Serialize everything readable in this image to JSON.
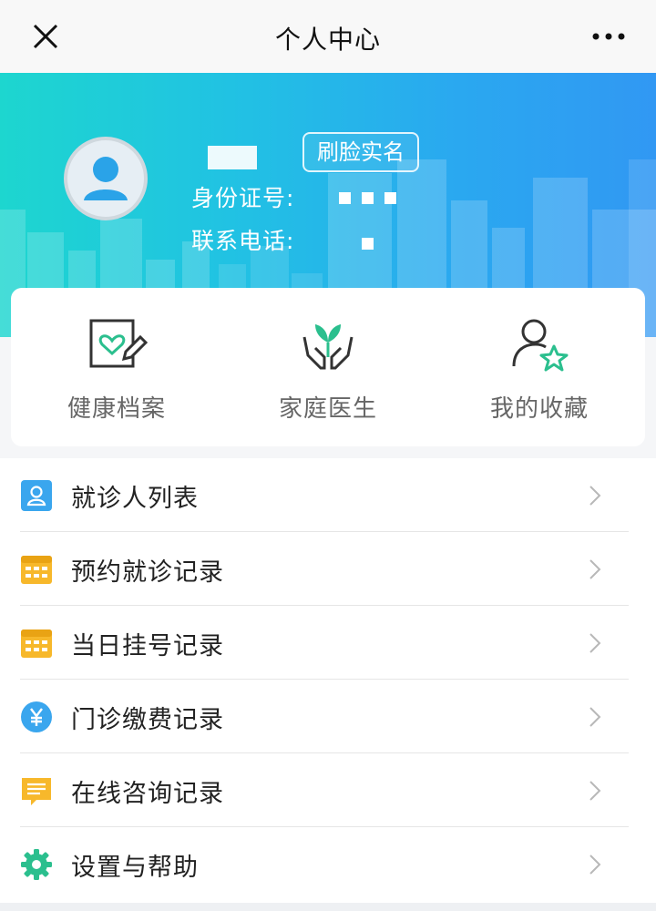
{
  "topbar": {
    "title": "个人中心",
    "close_icon": "close-icon",
    "more_icon": "more-dots-icon"
  },
  "profile": {
    "avatar_icon": "user-avatar-icon",
    "face_verify_label": "刷脸实名",
    "id_label": "身份证号:",
    "phone_label": "联系电话:"
  },
  "quick_actions": [
    {
      "label": "健康档案",
      "icon": "health-record-icon",
      "accent": "#2bbf8e"
    },
    {
      "label": "家庭医生",
      "icon": "family-doctor-icon",
      "accent": "#2bbf8e"
    },
    {
      "label": "我的收藏",
      "icon": "favorites-icon",
      "accent": "#2bbf8e"
    }
  ],
  "menu": [
    {
      "label": "就诊人列表",
      "icon": "patient-list-icon",
      "color": "#3aa6ee"
    },
    {
      "label": "预约就诊记录",
      "icon": "appointment-record-icon",
      "color": "#f7b82b"
    },
    {
      "label": "当日挂号记录",
      "icon": "registration-record-icon",
      "color": "#f7b82b"
    },
    {
      "label": "门诊缴费记录",
      "icon": "payment-record-icon",
      "color": "#3aa6ee"
    },
    {
      "label": "在线咨询记录",
      "icon": "consultation-record-icon",
      "color": "#f7b82b"
    },
    {
      "label": "设置与帮助",
      "icon": "settings-gear-icon",
      "color": "#2bbf8e"
    }
  ],
  "colors": {
    "header_gradient_start": "#1dd6cf",
    "header_gradient_end": "#3198f3",
    "chevron": "#b8b8b8"
  }
}
